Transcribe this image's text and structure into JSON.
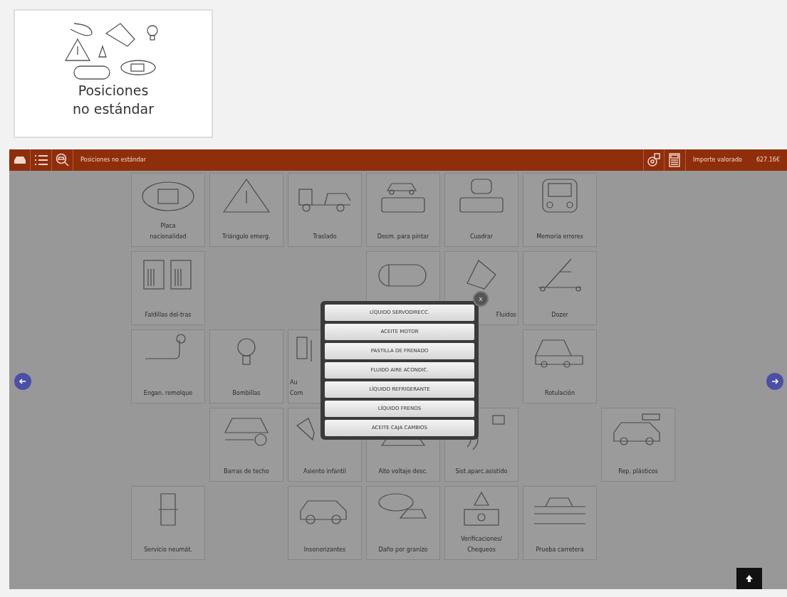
{
  "category_card": {
    "label_lines": [
      "Posiciones",
      "no estándar"
    ]
  },
  "toolbar": {
    "breadcrumb": "Posiciones no estándar",
    "total_label": "Importe valorado",
    "total_value": "627.16€"
  },
  "grid_rows": [
    [
      {
        "label_lines": [
          "Placa",
          "nacionalidad"
        ]
      },
      {
        "label_lines": [
          "Triángulo emerg."
        ]
      },
      {
        "label_lines": [
          "Traslado"
        ]
      },
      {
        "label_lines": [
          "Desm. para pintar"
        ]
      },
      {
        "label_lines": [
          "Cuadrar"
        ]
      },
      {
        "label_lines": [
          "Memoria errores"
        ]
      },
      null
    ],
    [
      {
        "label_lines": [
          "Faldillas del-tras"
        ]
      },
      null,
      null,
      {},
      {
        "label_lines": [
          "Fluidos"
        ]
      },
      {
        "label_lines": [
          "Dozer"
        ]
      },
      null
    ],
    [
      {
        "label_lines": [
          "Engan. remolque"
        ]
      },
      {
        "label_lines": [
          "Bombillas"
        ]
      },
      {
        "label_lines": [
          "Au",
          "Com"
        ]
      },
      null,
      null,
      {
        "label_lines": [
          "Rotulación"
        ]
      },
      null
    ],
    [
      null,
      {
        "label_lines": [
          "Barras de techo"
        ]
      },
      {
        "label_lines": [
          "Asiento infantil"
        ]
      },
      {
        "label_lines": [
          "Alto voltaje desc."
        ]
      },
      {
        "label_lines": [
          "Sist.aparc.asistido"
        ]
      },
      null,
      {
        "label_lines": [
          "Rep. plásticos"
        ]
      }
    ],
    [
      {
        "label_lines": [
          "Servicio neumát."
        ]
      },
      null,
      {
        "label_lines": [
          "Insonorizantes"
        ]
      },
      {
        "label_lines": [
          "Daño por granizo"
        ]
      },
      {
        "label_lines": [
          "Verificaciones/",
          "Chequeos"
        ]
      },
      {
        "label_lines": [
          "Prueba carretera"
        ]
      },
      null
    ]
  ],
  "popup": {
    "close": "x",
    "options": [
      "LÍQUIDO SERVODIRECC.",
      "ACEITE MOTOR",
      "PASTILLA DE FRENADO",
      "FLUIDO AIRE ACONDIC.",
      "LÍQUIDO REFRIGERANTE",
      "LÍQUIDO FRENOS",
      "ACEITE CAJA CAMBIOS"
    ]
  }
}
